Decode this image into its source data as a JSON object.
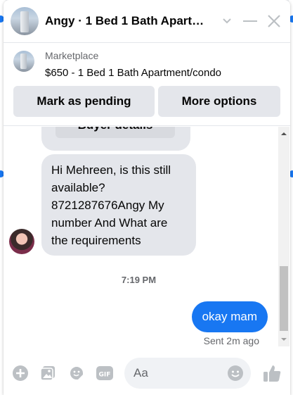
{
  "chat": {
    "title": "Angy · 1 Bed 1 Bath Apart…",
    "marketplace_label": "Marketplace",
    "listing": "$650 - 1 Bed 1 Bath Apartment/condo",
    "buttons": {
      "mark_pending": "Mark as pending",
      "more_options": "More options"
    },
    "partial_card_label": "Buyer details",
    "incoming_message": "Hi Mehreen, is this still available? 8721287676Angy My number And What are the requirements",
    "time_separator": "7:19 PM",
    "outgoing_message": "okay mam",
    "sent_status": "Sent 2m ago",
    "composer_placeholder": "Aa"
  },
  "colors": {
    "accent": "#1877f2",
    "bubble_in": "#e4e6eb",
    "icon": "#bcc0c4"
  }
}
